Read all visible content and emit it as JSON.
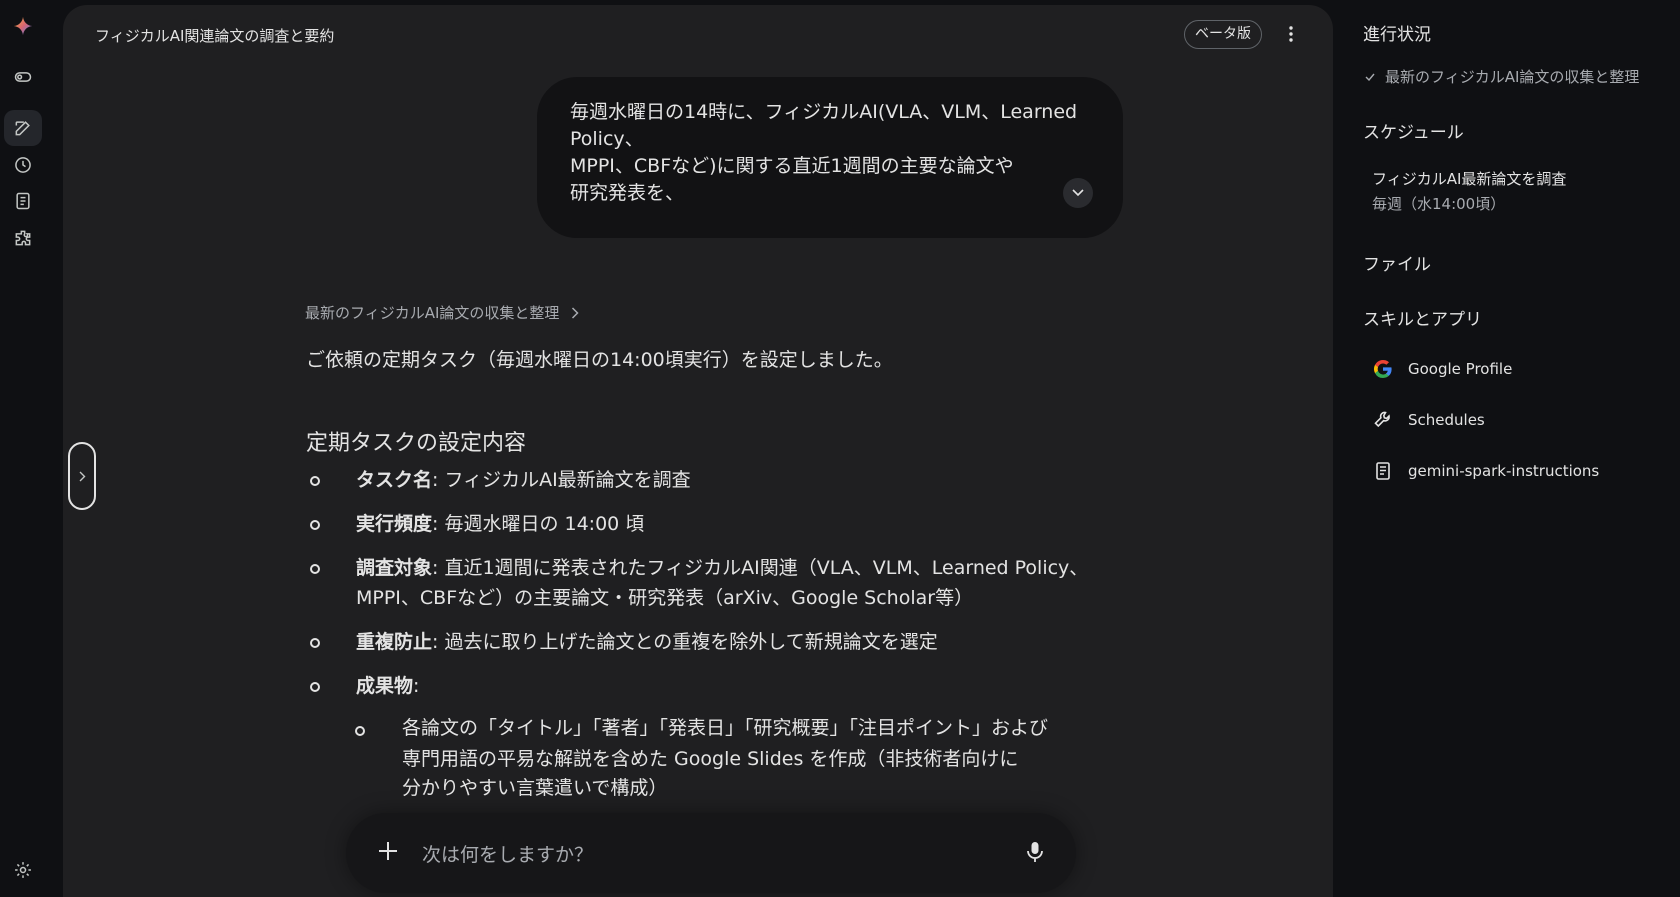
{
  "rail": {
    "items": [
      "gemini-logo",
      "toggle-icon",
      "new-chat-icon",
      "history-icon",
      "notebook-icon",
      "extensions-icon",
      "settings-icon"
    ]
  },
  "header": {
    "title": "フィジカルAI関連論文の調査と要約",
    "beta_label": "ベータ版"
  },
  "user_message": {
    "lines": [
      "毎週水曜日の14時に、フィジカルAI(VLA、VLM、Learned",
      "Policy、",
      "MPPI、CBFなど)に関する直近1週間の主要な論文や",
      "研究発表を、"
    ]
  },
  "response": {
    "thinking_label": "最新のフィジカルAI論文の収集と整理",
    "intro": "ご依頼の定期タスク（毎週水曜日の14:00頃実行）を設定しました。",
    "section_title": "定期タスクの設定内容",
    "items": [
      {
        "label": "タスク名",
        "text": ": フィジカルAI最新論文を調査"
      },
      {
        "label": "実行頻度",
        "text": ": 毎週水曜日の 14:00 頃"
      },
      {
        "label": "調査対象",
        "text": ": 直近1週間に発表されたフィジカルAI関連（VLA、VLM、Learned Policy、",
        "text2": "MPPI、CBFなど）の主要論文・研究発表（arXiv、Google Scholar等）"
      },
      {
        "label": "重複防止",
        "text": ": 過去に取り上げた論文との重複を除外して新規論文を選定"
      },
      {
        "label": "成果物",
        "text": ":"
      }
    ],
    "subitem_lines": [
      "各論文の「タイトル」「著者」「発表日」「研究概要」「注目ポイント」および",
      "専門用語の平易な解説を含めた Google Slides を作成（非技術者向けに",
      "分かりやすい言葉遣いで構成）"
    ]
  },
  "composer": {
    "placeholder": "次は何をしますか？"
  },
  "panel": {
    "progress_title": "進行状況",
    "progress_item": "最新のフィジカルAI論文の収集と整理",
    "schedule_title": "スケジュール",
    "schedule_name": "フィジカルAI最新論文を調査",
    "schedule_freq": "毎週（水14:00頃）",
    "files_title": "ファイル",
    "apps_title": "スキルとアプリ",
    "apps": [
      "Google Profile",
      "Schedules",
      "gemini-spark-instructions"
    ]
  },
  "colors": {
    "background": "#0f1013",
    "surface": "#1f1f21",
    "bubble": "#121214",
    "text": "#e3e3e3",
    "muted": "#a8abb0"
  }
}
